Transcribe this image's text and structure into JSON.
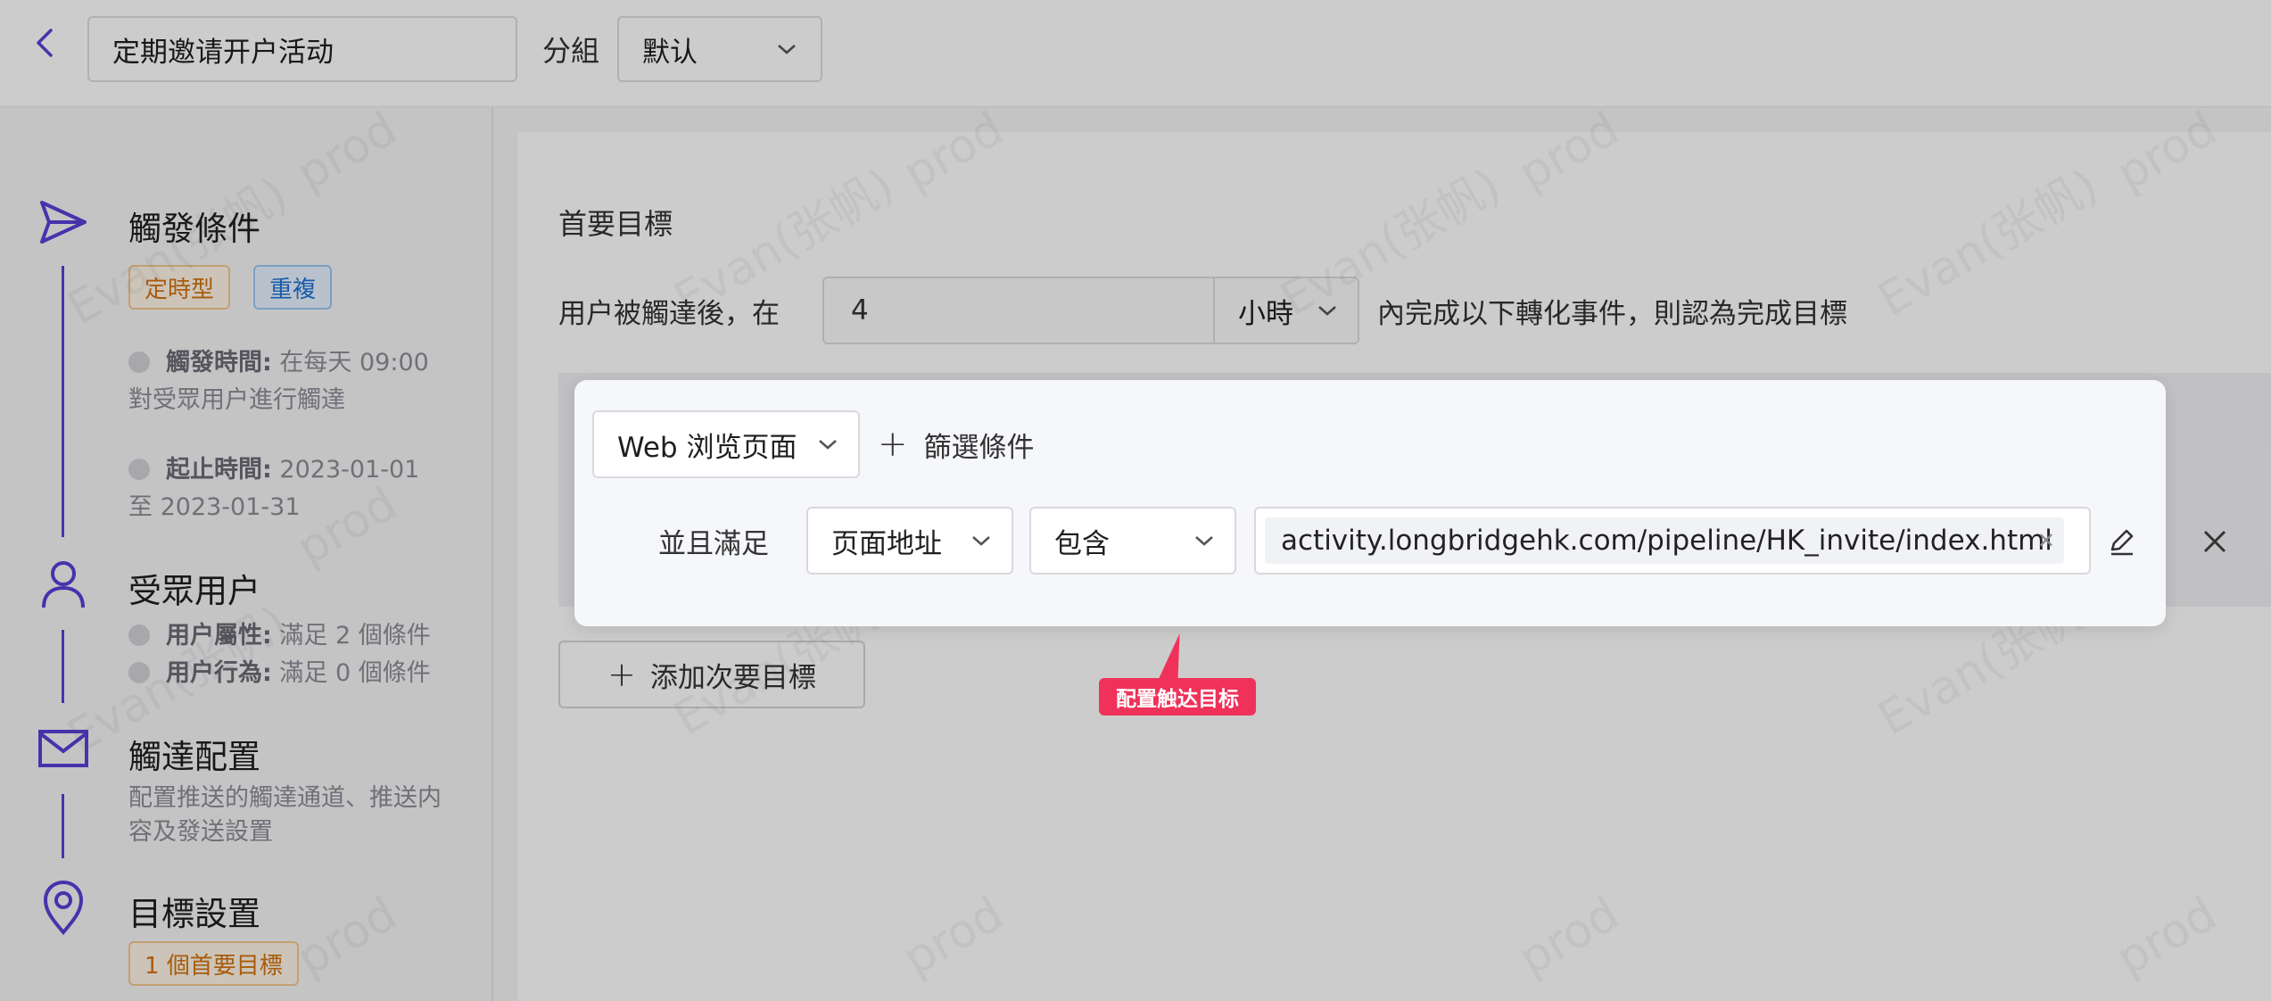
{
  "header": {
    "campaign_name": "定期邀请开户活动",
    "group_label": "分組",
    "group_value": "默认"
  },
  "sidebar": {
    "trigger": {
      "title": "觸發條件",
      "tags": [
        "定時型",
        "重複"
      ],
      "trigger_time_label": "觸發時間:",
      "trigger_time_value": "在每天 09:00",
      "trigger_time_cont": "對受眾用户進行觸達",
      "period_label": "起止時間:",
      "period_value": "2023-01-01",
      "period_cont": "至 2023-01-31"
    },
    "audience": {
      "title": "受眾用户",
      "attr_label": "用户屬性:",
      "attr_value": "滿足 2 個條件",
      "behavior_label": "用户行為:",
      "behavior_value": "滿足 0 個條件"
    },
    "delivery": {
      "title": "觸達配置",
      "desc_line1": "配置推送的觸達通道、推送内",
      "desc_line2": "容及發送設置"
    },
    "goal": {
      "title": "目標設置",
      "tag": "1 個首要目標"
    }
  },
  "main": {
    "primary_title": "首要目標",
    "goal_prefix": "用户被觸達後，在",
    "goal_number": "4",
    "goal_unit": "小時",
    "goal_suffix": "內完成以下轉化事件，則認為完成目標",
    "add_secondary": "添加次要目標"
  },
  "card": {
    "event": "Web 浏览页面",
    "add_filter": "篩選條件",
    "and_label": "並且滿足",
    "property": "页面地址",
    "operator": "包含",
    "value": "activity.longbridgehk.com/pipeline/HK_invite/index.html"
  },
  "tooltip": "配置触达目标",
  "watermark": [
    "Evan(张帆)",
    "prod"
  ],
  "colors": {
    "accent": "#5b3fd8",
    "tooltip": "#f0325a",
    "tag_orange": "#d4730f",
    "tag_blue": "#1f74d2"
  }
}
